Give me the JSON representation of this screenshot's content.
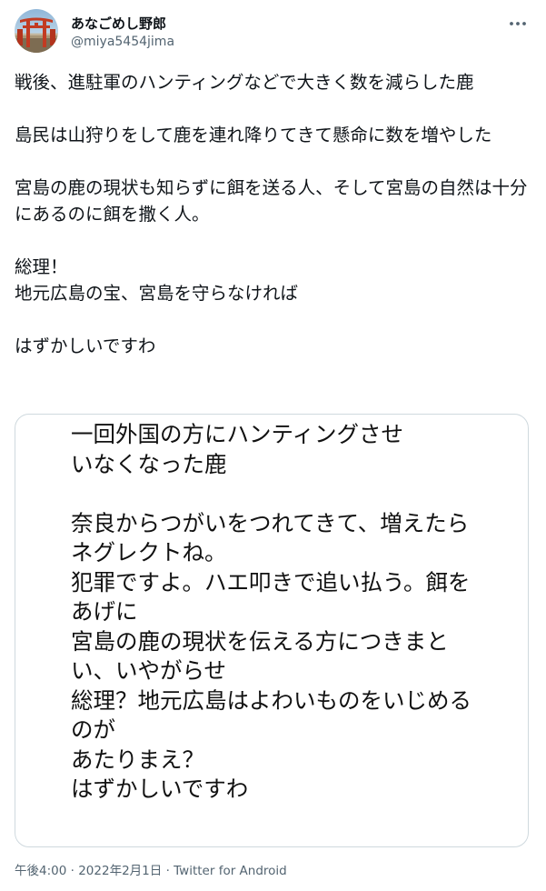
{
  "user": {
    "display_name": "あなごめし野郎",
    "handle": "@miya5454jima",
    "avatar_icon": "torii-gate-avatar"
  },
  "menu": {
    "more_icon": "more-horizontal-icon"
  },
  "tweet": {
    "paragraphs": [
      "戦後、進駐軍のハンティングなどで大きく数を減らした鹿",
      "島民は山狩りをして鹿を連れ降りてきて懸命に数を増やした",
      "宮島の鹿の現状も知らずに餌を送る人、そして宮島の自然は十分にあるのに餌を撒く人。",
      "総理！\n地元広島の宝、宮島を守らなければ",
      "はずかしいですわ"
    ]
  },
  "media": {
    "lines": [
      "一回外国の方にハンティングさせ",
      "いなくなった鹿",
      "",
      "奈良からつがいをつれてきて、増えたら",
      "ネグレクトね。",
      "犯罪ですよ。ハエ叩きで追い払う。餌を",
      "あげに",
      "宮島の鹿の現状を伝える方につきまと",
      "い、いやがらせ",
      "総理？地元広島はよわいものをいじめる",
      "のが",
      "あたりまえ？",
      "はずかしいですわ"
    ]
  },
  "meta": {
    "time": "午後4:00",
    "separator": "·",
    "date": "2022年2月1日",
    "source": "Twitter for Android"
  }
}
